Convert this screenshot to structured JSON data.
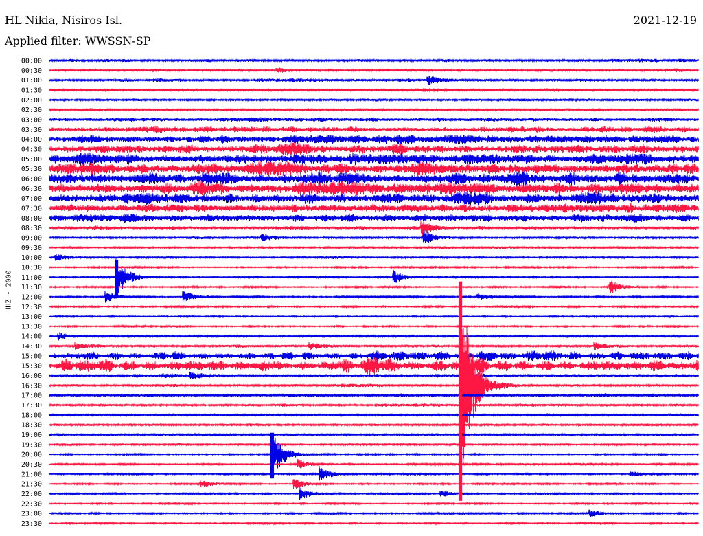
{
  "header": {
    "station": "HL Nikia, Nisiros Isl.",
    "date": "2021-12-19",
    "filter": "Applied filter: WWSSN-SP"
  },
  "chart_data": {
    "type": "helicorder",
    "title": "HL Nikia, Nisiros Isl.",
    "subtitle": "Applied filter: WWSSN-SP",
    "date": "2021-12-19",
    "ylabel": "HHZ - 2000",
    "trace_minutes": 30,
    "tick_labels": [
      "00:00",
      "00:30",
      "01:00",
      "01:30",
      "02:00",
      "02:30",
      "03:00",
      "03:30",
      "04:00",
      "04:30",
      "05:00",
      "05:30",
      "06:00",
      "06:30",
      "07:00",
      "07:30",
      "08:00",
      "08:30",
      "09:00",
      "09:30",
      "10:00",
      "10:30",
      "11:00",
      "11:30",
      "12:00",
      "12:30",
      "13:00",
      "13:30",
      "14:00",
      "14:30",
      "15:00",
      "15:30",
      "16:00",
      "16:30",
      "17:00",
      "17:30",
      "18:00",
      "18:30",
      "19:00",
      "19:30",
      "20:00",
      "20:30",
      "21:00",
      "21:30",
      "22:00",
      "22:30",
      "23:00",
      "23:30"
    ],
    "colors": [
      "#0000e6",
      "#ff1744"
    ],
    "noise_level": [
      0.35,
      0.3,
      0.35,
      0.35,
      0.3,
      0.35,
      0.5,
      0.75,
      0.9,
      1.1,
      1.25,
      1.3,
      1.35,
      1.35,
      1.25,
      1.1,
      0.9,
      0.4,
      0.3,
      0.25,
      0.25,
      0.2,
      0.2,
      0.2,
      0.2,
      0.2,
      0.2,
      0.2,
      0.25,
      0.35,
      0.7,
      1.0,
      0.4,
      0.3,
      0.35,
      0.3,
      0.3,
      0.3,
      0.3,
      0.25,
      0.2,
      0.2,
      0.2,
      0.2,
      0.2,
      0.2,
      0.2,
      0.2
    ],
    "events": [
      {
        "trace": 1,
        "minute": 10.5,
        "amplitude": 0.6
      },
      {
        "trace": 2,
        "minute": 17.5,
        "amplitude": 0.9
      },
      {
        "trace": 17,
        "minute": 17.2,
        "amplitude": 1.6
      },
      {
        "trace": 18,
        "minute": 9.8,
        "amplitude": 0.8
      },
      {
        "trace": 18,
        "minute": 17.3,
        "amplitude": 1.6
      },
      {
        "trace": 20,
        "minute": 0.3,
        "amplitude": 0.7
      },
      {
        "trace": 22,
        "minute": 3.1,
        "amplitude": 4.0
      },
      {
        "trace": 22,
        "minute": 15.9,
        "amplitude": 1.5
      },
      {
        "trace": 23,
        "minute": 25.9,
        "amplitude": 1.4
      },
      {
        "trace": 24,
        "minute": 2.6,
        "amplitude": 1.2
      },
      {
        "trace": 24,
        "minute": 6.2,
        "amplitude": 1.3
      },
      {
        "trace": 24,
        "minute": 19.8,
        "amplitude": 0.6
      },
      {
        "trace": 28,
        "minute": 0.4,
        "amplitude": 0.8
      },
      {
        "trace": 29,
        "minute": 1.2,
        "amplitude": 0.6
      },
      {
        "trace": 29,
        "minute": 12.0,
        "amplitude": 0.7
      },
      {
        "trace": 29,
        "minute": 25.2,
        "amplitude": 0.7
      },
      {
        "trace": 32,
        "minute": 6.5,
        "amplitude": 0.6
      },
      {
        "trace": 33,
        "minute": 19.0,
        "amplitude": 24.0
      },
      {
        "trace": 40,
        "minute": 10.3,
        "amplitude": 5.0
      },
      {
        "trace": 41,
        "minute": 11.5,
        "amplitude": 1.0
      },
      {
        "trace": 42,
        "minute": 12.5,
        "amplitude": 1.6
      },
      {
        "trace": 42,
        "minute": 26.9,
        "amplitude": 0.6
      },
      {
        "trace": 43,
        "minute": 7.0,
        "amplitude": 0.6
      },
      {
        "trace": 43,
        "minute": 11.3,
        "amplitude": 1.2
      },
      {
        "trace": 44,
        "minute": 11.6,
        "amplitude": 1.3
      },
      {
        "trace": 44,
        "minute": 18.1,
        "amplitude": 0.7
      },
      {
        "trace": 46,
        "minute": 25.0,
        "amplitude": 0.7
      }
    ]
  }
}
